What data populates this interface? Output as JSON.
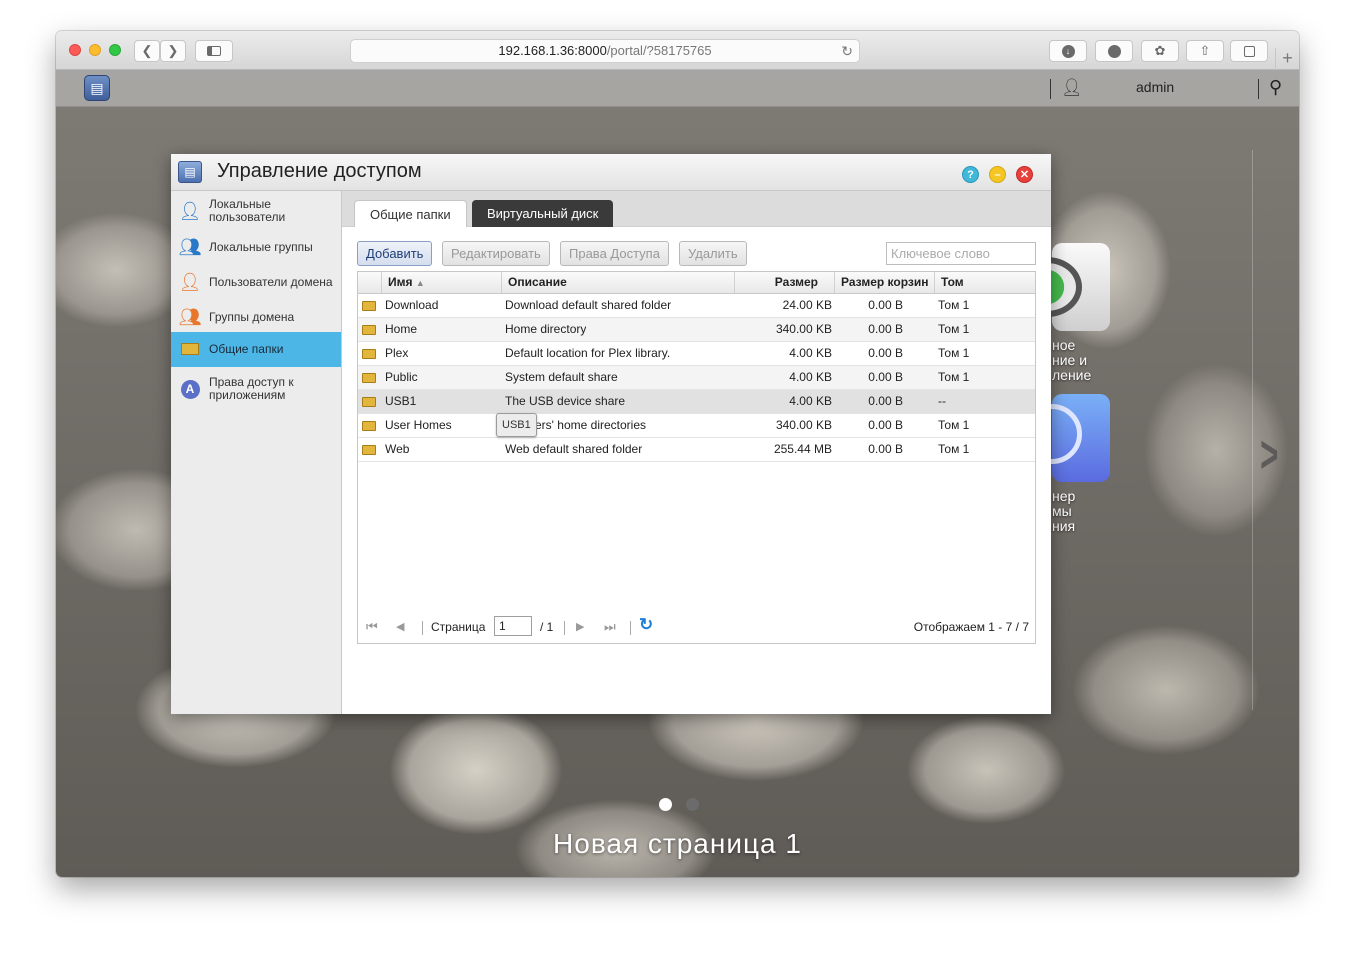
{
  "browser": {
    "url_host": "192.168.1.36:8000",
    "url_path": "/portal/?58175765"
  },
  "topbar": {
    "user": "admin"
  },
  "desktop": {
    "page_title": "Новая страница 1",
    "app1_label": [
      "ное",
      "ние и",
      "ление"
    ],
    "app2_label": [
      "нер",
      "мы",
      "ния"
    ]
  },
  "window": {
    "title": "Управление доступом",
    "sidebar": [
      {
        "label": "Локальные пользователи"
      },
      {
        "label": "Локальные группы"
      },
      {
        "label": "Пользователи домена"
      },
      {
        "label": "Группы домена"
      },
      {
        "label": "Общие папки"
      },
      {
        "label": "Права доступ к приложениям"
      }
    ],
    "tabs": [
      "Общие папки",
      "Виртуальный диск"
    ],
    "toolbar": {
      "add": "Добавить",
      "edit": "Редактировать",
      "permissions": "Права Доступа",
      "delete": "Удалить",
      "search_placeholder": "Ключевое слово"
    },
    "table": {
      "columns": [
        "Имя",
        "Описание",
        "Размер",
        "Размер корзин",
        "Том"
      ],
      "rows": [
        {
          "name": "Download",
          "desc": "Download default shared folder",
          "size": "24.00 KB",
          "trash": "0.00 B",
          "vol": "Том 1"
        },
        {
          "name": "Home",
          "desc": "Home directory",
          "size": "340.00 KB",
          "trash": "0.00 B",
          "vol": "Том 1"
        },
        {
          "name": "Plex",
          "desc": "Default location for Plex library.",
          "size": "4.00 KB",
          "trash": "0.00 B",
          "vol": "Том 1"
        },
        {
          "name": "Public",
          "desc": "System default share",
          "size": "4.00 KB",
          "trash": "0.00 B",
          "vol": "Том 1"
        },
        {
          "name": "USB1",
          "desc": "The USB device share",
          "size": "4.00 KB",
          "trash": "0.00 B",
          "vol": "--"
        },
        {
          "name": "User Homes",
          "desc": "ers' home directories",
          "size": "340.00 KB",
          "trash": "0.00 B",
          "vol": "Том 1"
        },
        {
          "name": "Web",
          "desc": "Web default shared folder",
          "size": "255.44 MB",
          "trash": "0.00 B",
          "vol": "Том 1"
        }
      ],
      "tooltip": "USB1"
    },
    "pager": {
      "page_label": "Страница",
      "page_value": "1",
      "page_total": "/ 1",
      "status": "Отображаем 1 - 7 / 7"
    }
  }
}
